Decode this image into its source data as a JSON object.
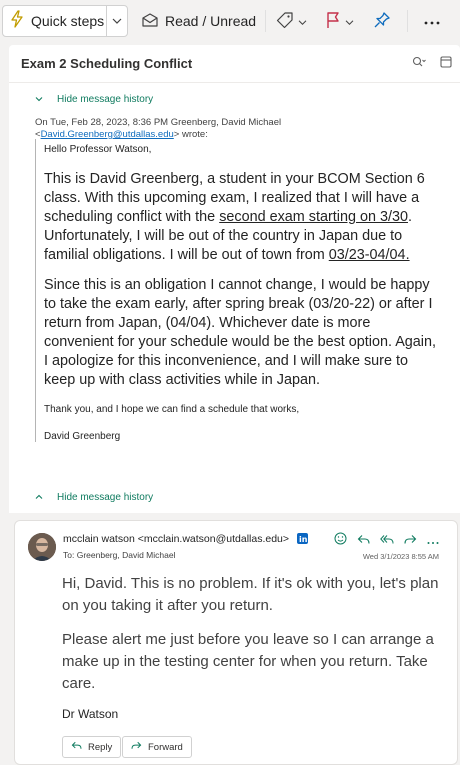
{
  "toolbar": {
    "quick_steps_label": "Quick steps",
    "read_unread_label": "Read / Unread",
    "icons": [
      "lightning-icon",
      "envelope-icon",
      "tag-icon",
      "flag-icon",
      "pin-icon",
      "more-icon"
    ],
    "accent_color": "#c4314b",
    "pin_color": "#0f6cbd"
  },
  "subject": "Exam 2 Scheduling Conflict",
  "history": {
    "hide_label_top": "Hide message history",
    "hide_label_bottom": "Hide message history"
  },
  "quoted": {
    "header_line1": "On Tue, Feb 28, 2023, 8:36 PM Greenberg, David Michael",
    "header_lt": "<",
    "email": "David.Greenberg@utdallas.edu",
    "header_tail": "> wrote:",
    "greeting": "Hello Professor Watson,",
    "p1_part1": "This is David Greenberg, a student in your BCOM Section 6 class. With this upcoming exam, I realized that I will have a scheduling conflict with the ",
    "p1_link": "second exam starting on 3/30",
    "p1_part2": ". Unfortunately, I will be out of the country in Japan due to familial obligations. I will be out of town from ",
    "p1_dates": "03/23-04/04.",
    "p2": "Since this is an obligation I cannot change, I would be happy to take the exam early, after spring break (03/20-22) or after I return from Japan, (04/04). Whichever date is more convenient for your schedule would be the best option. Again, I apologize for this inconvenience, and I will make sure to keep up with class activities while in Japan.",
    "closing": "Thank you, and I hope we can find a schedule that works,",
    "signature": "David Greenberg"
  },
  "reply": {
    "from": "mcclain watson <mcclain.watson@utdallas.edu>",
    "to_label": "To:",
    "to": "Greenberg, David Michael",
    "date": "Wed 3/1/2023 8:55 AM",
    "p1": "Hi, David. This is no problem. If it's ok with you, let's plan on you taking it after you return.",
    "p2": "Please alert me just before you leave so I can arrange a make up in the testing center for when you return. Take care.",
    "signature": "Dr Watson",
    "reply_label": "Reply",
    "forward_label": "Forward"
  }
}
